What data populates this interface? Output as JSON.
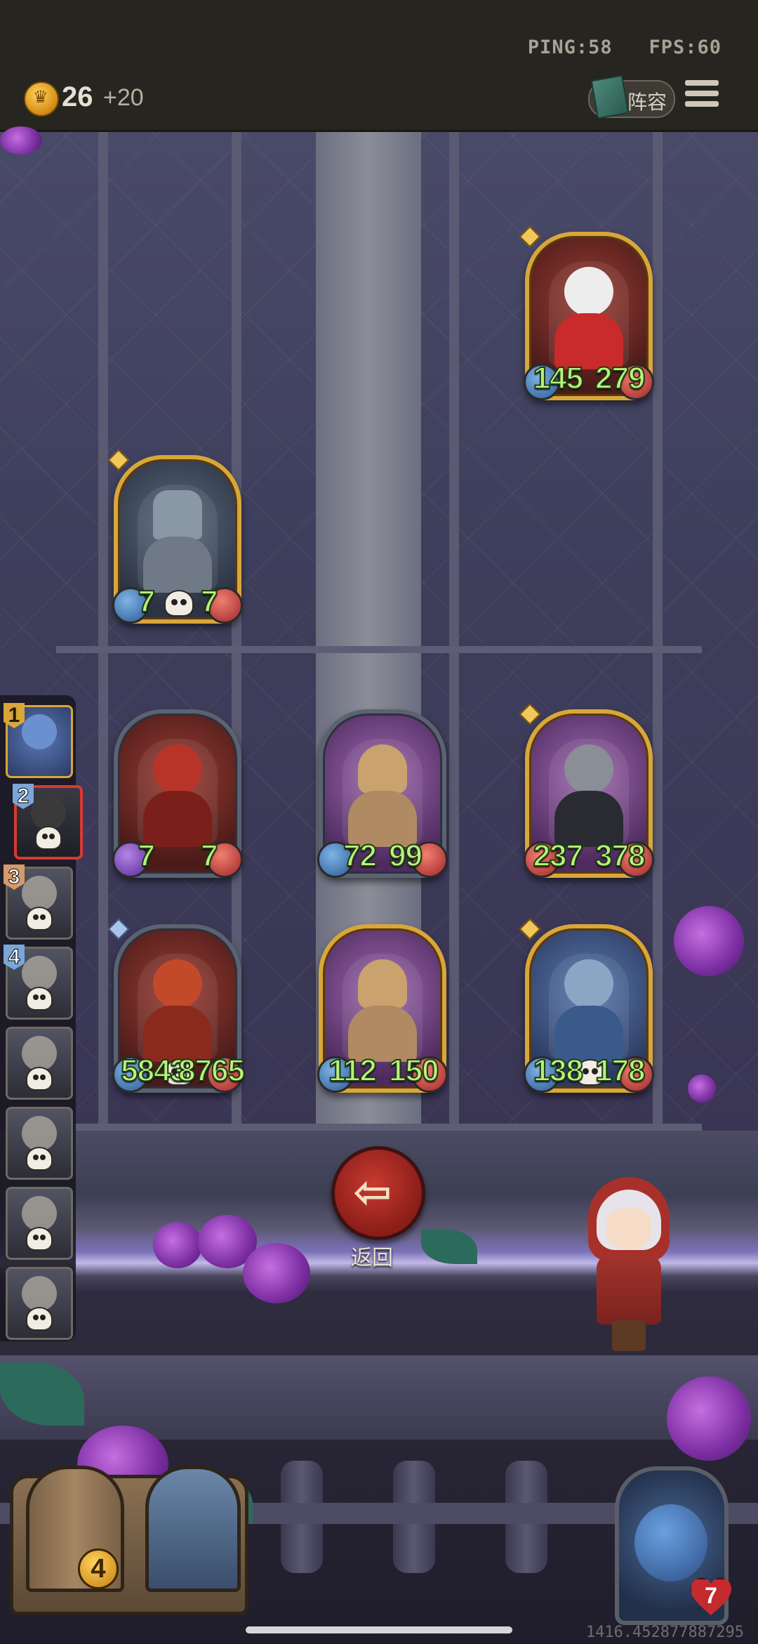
{
  "status": {
    "ping": "PING:58",
    "fps": "FPS:60"
  },
  "currency": {
    "icon": "crown-coin-icon",
    "amount": "26",
    "income": "+20"
  },
  "toolbar": {
    "lineup_label": "阵容",
    "lineup_icon": "book-icon",
    "menu_icon": "menu-icon"
  },
  "board": {
    "units": [
      {
        "name": "clown",
        "atk": "145",
        "hp": "279"
      },
      {
        "name": "robot",
        "atk": "7",
        "hp": "7"
      },
      {
        "name": "hooded-assassin",
        "atk": "7",
        "hp": "7"
      },
      {
        "name": "detective-1",
        "atk": "72",
        "hp": "99"
      },
      {
        "name": "vampire",
        "atk": "237",
        "hp": "378"
      },
      {
        "name": "lava-dragon",
        "atk": "5843",
        "hp": "8765"
      },
      {
        "name": "detective-2",
        "atk": "112",
        "hp": "150"
      },
      {
        "name": "elf-sorceress",
        "atk": "138",
        "hp": "178"
      }
    ]
  },
  "back_button": {
    "label": "返回",
    "icon": "arrow-left-icon"
  },
  "sidebar": {
    "slots": [
      {
        "rank": "1"
      },
      {
        "rank": "2"
      },
      {
        "rank": "3"
      },
      {
        "rank": "4"
      },
      {
        "rank": ""
      },
      {
        "rank": ""
      },
      {
        "rank": ""
      },
      {
        "rank": ""
      }
    ]
  },
  "bench": {
    "count": "4"
  },
  "player": {
    "health": "7"
  },
  "debug": {
    "coordinates": "1416.452877887295"
  }
}
